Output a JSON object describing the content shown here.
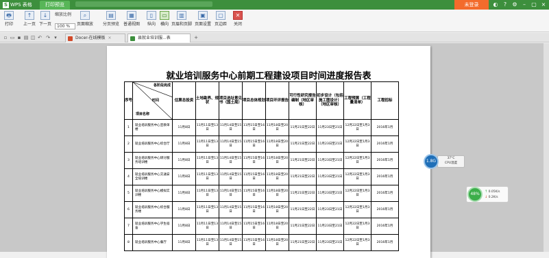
{
  "app": {
    "brand": "WPS 表格",
    "active_tab": "打印预览",
    "login_label": "未登录"
  },
  "toolbar": {
    "print": "打印",
    "prev": "上一页",
    "next": "下一页",
    "zoom_label": "缩放比例",
    "zoom_value": "100 %",
    "page_zoom": "页面缩放",
    "page_break": "分页预览",
    "normal_view": "普通视图",
    "portrait": "纵向",
    "landscape": "横向",
    "header_footer": "页眉和页脚",
    "page_setup": "页面设置",
    "margins": "页边距",
    "close": "关闭"
  },
  "tabs": [
    {
      "label": "Docer-在线模板",
      "close": "×"
    },
    {
      "label": "县就业培训服...表表.xls",
      "close": "×"
    }
  ],
  "document": {
    "title": "就业培训服务中心前期工程建设项目时间进度报告表",
    "header": {
      "seq": "序号",
      "diag_top": "各阶段完成",
      "diag_mid": "时间",
      "diag_bottom": "项目名称",
      "cols": [
        "估算总投资",
        "土地勘界、规状",
        "项目选址意见书（国土局）",
        "项目总体规划",
        "项目环评报告",
        "可行性研究报告编制（地区审核）",
        "初步设计（包括施工图设计）（地区审核）",
        "工程预算（工程量清单）",
        "工程招标"
      ]
    },
    "rows": [
      {
        "no": "1",
        "name": "就业培训服务中心宣教单楼",
        "cells": [
          "11月8日",
          "11月11日至13日",
          "11月14日至15日",
          "11月15日至16日",
          "11月18日至20日",
          "11月21日至22日",
          "11月23日至21日",
          "12月22日至1月3日",
          "2016年1月"
        ]
      },
      {
        "no": "2",
        "name": "就业培训服务中心综合厅",
        "cells": [
          "11月8日",
          "11月11日至13日",
          "11月14日至15日",
          "11月15日至16日",
          "11月18日至20日",
          "11月21日至22日",
          "11月23日至21日",
          "12月22日至1月3日",
          "2016年1月"
        ]
      },
      {
        "no": "3",
        "name": "就业培训服务中心研讨服务培训楼",
        "cells": [
          "11月8日",
          "11月11日至13日",
          "11月14日至15日",
          "11月15日至16日",
          "11月18日至20日",
          "11月21日至22日",
          "11月23日至21日",
          "12月22日至1月3日",
          "2016年1月"
        ]
      },
      {
        "no": "4",
        "name": "就业培训服务中心交通安全培训楼",
        "cells": [
          "11月8日",
          "11月11日至13日",
          "11月14日至15日",
          "11月15日至16日",
          "11月18日至20日",
          "11月21日至22日",
          "11月23日至21日",
          "12月22日至1月3日",
          "2016年1月"
        ]
      },
      {
        "no": "5",
        "name": "就业培训服务中心模拟实训楼",
        "cells": [
          "11月8日",
          "11月11日至13日",
          "11月14日至15日",
          "11月15日至16日",
          "11月18日至20日",
          "11月21日至22日",
          "11月23日至21日",
          "12月22日至1月3日",
          "2016年1月"
        ]
      },
      {
        "no": "6",
        "name": "就业培训服务中心综合服务楼",
        "cells": [
          "11月8日",
          "11月11日至13日",
          "11月14日至15日",
          "11月15日至16日",
          "11月18日至20日",
          "11月21日至22日",
          "11月23日至21日",
          "12月22日至1月3日",
          "2016年1月"
        ]
      },
      {
        "no": "7",
        "name": "就业培训服务中心学生宿舍",
        "cells": [
          "11月8日",
          "11月11日至13日",
          "11月14日至15日",
          "11月15日至16日",
          "11月18日至20日",
          "11月21日至22日",
          "11月23日至21日",
          "12月22日至1月3日",
          "2016年1月"
        ]
      },
      {
        "no": "8",
        "name": "就业培训服务中心餐厅",
        "cells": [
          "11月8日",
          "11月11日至13日",
          "11月14日至15日",
          "11月15日至16日",
          "11月18日至20日",
          "11月21日至22日",
          "11月23日至21日",
          "12月22日至1月3日",
          "2016年1月"
        ]
      }
    ]
  },
  "widgets": {
    "cpu_value": "1.8G",
    "cpu_temp": "37°C",
    "cpu_label": "CPU温度",
    "net_percent": "48%",
    "net_up": "0.05K/s",
    "net_down": "0.2K/s"
  },
  "colors": {
    "brand_green": "#3d8f3d",
    "login_orange": "#f36b2c"
  }
}
